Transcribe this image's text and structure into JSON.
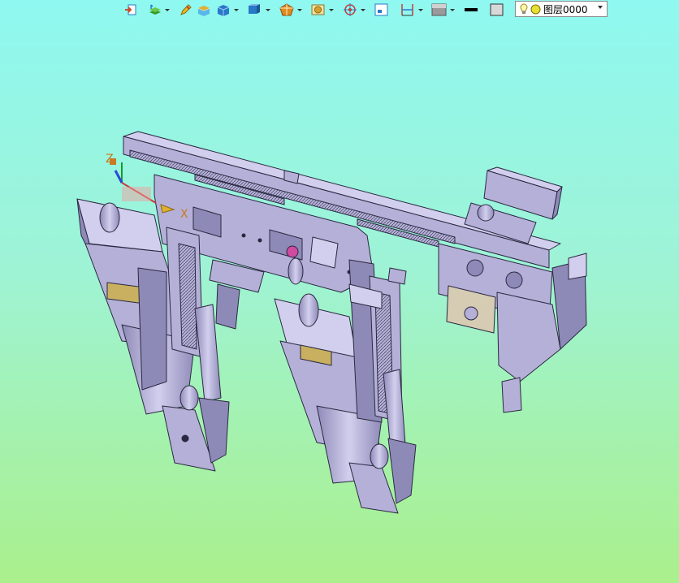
{
  "toolbar": {
    "buttons": [
      {
        "name": "import-icon",
        "color": "#d04a2a",
        "dropdown": false
      },
      {
        "name": "layers-stack-icon",
        "color": "#3a9a2a",
        "dropdown": true
      },
      {
        "name": "pencil-icon",
        "color": "#e6b820",
        "dropdown": false
      },
      {
        "name": "box-solid-icon",
        "color": "#e0b030",
        "dropdown": false
      },
      {
        "name": "cube-icon",
        "color": "#2a78c8",
        "dropdown": true
      },
      {
        "name": "cube-view-icon",
        "color": "#2a78c8",
        "dropdown": true
      },
      {
        "name": "render-mode-icon",
        "color": "#e08a20",
        "dropdown": true
      },
      {
        "name": "snapshot-icon",
        "color": "#d8a030",
        "dropdown": true
      },
      {
        "name": "target-icon",
        "color": "#c83a3a",
        "dropdown": true
      },
      {
        "name": "frame-icon",
        "color": "#2a78c8",
        "dropdown": false
      },
      {
        "name": "dimension-icon",
        "color": "#c83a3a",
        "dropdown": true
      },
      {
        "name": "background-icon",
        "color": "#6a6a6a",
        "dropdown": true
      },
      {
        "name": "line-weight-icon",
        "color": "#000000",
        "dropdown": false
      },
      {
        "name": "fill-swatch-icon",
        "color": "#d8d8d8",
        "dropdown": false
      },
      {
        "name": "layer-manager-icon",
        "color": "#3a9a8a",
        "dropdown": true
      }
    ]
  },
  "layer": {
    "current": "图层0000"
  },
  "axes": {
    "z_label": "Z",
    "x_label": "X"
  },
  "colors": {
    "part_fill": "#b4b0d8",
    "part_dark": "#8e8ab8",
    "part_light": "#d2cfee",
    "edge": "#2a2840",
    "label_brass": "#c8b060",
    "plate_beige": "#d6ccb4"
  }
}
